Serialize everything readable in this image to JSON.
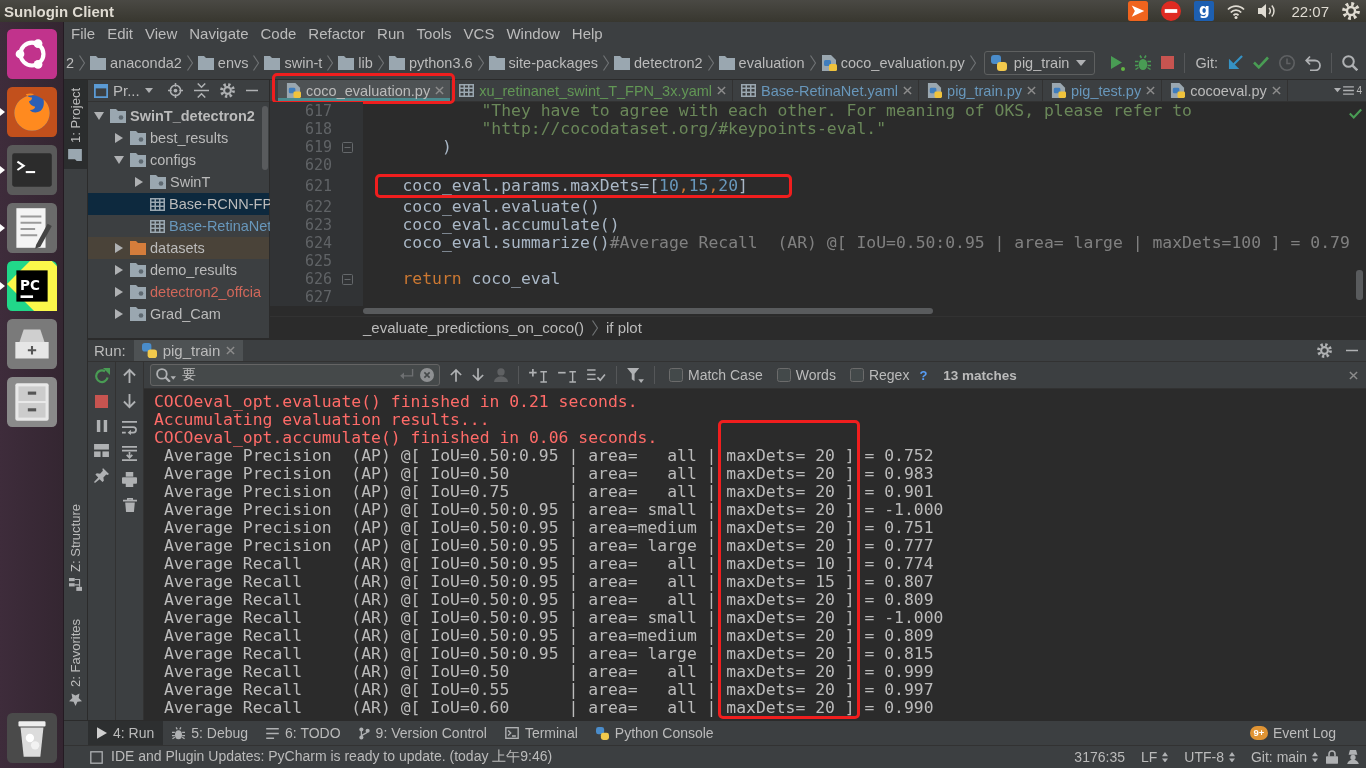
{
  "top_bar": {
    "title": "Sunlogin Client",
    "tray": [
      {
        "kind": "remote"
      },
      {
        "kind": "blocked"
      },
      {
        "kind": "keyboard",
        "label": "g"
      },
      {
        "kind": "wifi"
      },
      {
        "kind": "volume"
      }
    ],
    "clock": "22:07"
  },
  "launcher": [
    {
      "kind": "dash",
      "running": false
    },
    {
      "kind": "browser",
      "running": true
    },
    {
      "kind": "terminal",
      "running": true
    },
    {
      "kind": "editor",
      "running": true
    },
    {
      "kind": "ide",
      "label": "PC",
      "running": true
    },
    {
      "kind": "drive",
      "running": false
    },
    {
      "kind": "cabinet",
      "running": false
    },
    {
      "kind": "trash",
      "running": false
    }
  ],
  "menu": [
    "File",
    "Edit",
    "View",
    "Navigate",
    "Code",
    "Refactor",
    "Run",
    "Tools",
    "VCS",
    "Window",
    "Help"
  ],
  "navigation_bar": {
    "path": [
      {
        "kind": "text",
        "label": "2"
      },
      {
        "kind": "folder",
        "label": "anaconda2"
      },
      {
        "kind": "folder",
        "label": "envs"
      },
      {
        "kind": "folder",
        "label": "swin-t"
      },
      {
        "kind": "folder",
        "label": "lib"
      },
      {
        "kind": "folder",
        "label": "python3.6"
      },
      {
        "kind": "folder",
        "label": "site-packages"
      },
      {
        "kind": "folder",
        "label": "detectron2"
      },
      {
        "kind": "folder",
        "label": "evaluation"
      },
      {
        "kind": "python",
        "label": "coco_evaluation.py"
      }
    ],
    "run_config": "pig_train",
    "vcs_label": "Git:"
  },
  "side_stripe": [
    {
      "label": "1: Project",
      "kind": "project",
      "selected": true
    },
    {
      "label": "Z: Structure",
      "kind": "structure",
      "selected": false
    },
    {
      "label": "2: Favorites",
      "kind": "favorites",
      "selected": false
    }
  ],
  "project": {
    "title": "Pr...",
    "tree": [
      {
        "label": "SwinT_detectron2",
        "kind": "folder",
        "expanded": true,
        "selected": false,
        "children": [
          {
            "label": "best_results",
            "kind": "folder",
            "expanded": false,
            "selected": false
          },
          {
            "label": "configs",
            "kind": "folder",
            "expanded": true,
            "selected": false,
            "children": [
              {
                "label": "SwinT",
                "kind": "folder",
                "expanded": false,
                "selected": false
              },
              {
                "label": "Base-RCNN-FP",
                "kind": "yaml",
                "selected": true
              },
              {
                "label": "Base-RetinaNet",
                "kind": "yaml",
                "selected": false,
                "color": "#6897bb"
              }
            ]
          },
          {
            "label": "datasets",
            "kind": "excluded",
            "expanded": false,
            "selected": false
          },
          {
            "label": "demo_results",
            "kind": "folder",
            "expanded": false,
            "selected": false
          },
          {
            "label": "detectron2_offcia",
            "kind": "folder",
            "expanded": false,
            "selected": false,
            "color": "#d1675a"
          },
          {
            "label": "Grad_Cam",
            "kind": "folder",
            "expanded": false,
            "selected": false
          }
        ]
      }
    ]
  },
  "editor": {
    "tabs": [
      {
        "label": "coco_evaluation.py",
        "kind": "python",
        "selected": true,
        "highlighted": true
      },
      {
        "label": "xu_retinanet_swint_T_FPN_3x.yaml",
        "kind": "yaml",
        "selected": false,
        "highlighted": false,
        "color": "#629755"
      },
      {
        "label": "Base-RetinaNet.yaml",
        "kind": "yaml",
        "selected": false,
        "highlighted": false,
        "color": "#6897bb"
      },
      {
        "label": "pig_train.py",
        "kind": "python",
        "selected": false,
        "highlighted": false,
        "color": "#6897bb"
      },
      {
        "label": "pig_test.py",
        "kind": "python",
        "selected": false,
        "highlighted": false,
        "color": "#6897bb"
      },
      {
        "label": "cocoeval.py",
        "kind": "python",
        "selected": false,
        "highlighted": false
      }
    ],
    "hidden_tabs": "4",
    "lines": [
      {
        "number": "617",
        "highlighted": false,
        "fold": false,
        "tokens": [
          {
            "kind": "string",
            "text": "            \"They have to agree with each other. For meaning of OKS, please refer to"
          }
        ]
      },
      {
        "number": "618",
        "highlighted": false,
        "fold": false,
        "tokens": [
          {
            "kind": "string",
            "text": "            \"http://cocodataset.org/#keypoints-eval.\""
          }
        ]
      },
      {
        "number": "619",
        "highlighted": false,
        "fold": true,
        "tokens": [
          {
            "kind": "plain",
            "text": "        )"
          }
        ]
      },
      {
        "number": "620",
        "highlighted": false,
        "fold": false
      },
      {
        "number": "621",
        "highlighted": true,
        "fold": false,
        "tokens": [
          {
            "kind": "plain",
            "text": "    coco_eval.params.maxDets=["
          },
          {
            "kind": "number",
            "text": "10"
          },
          {
            "kind": "punct",
            "text": ","
          },
          {
            "kind": "number",
            "text": "15"
          },
          {
            "kind": "punct",
            "text": ","
          },
          {
            "kind": "number",
            "text": "20"
          },
          {
            "kind": "plain",
            "text": "]"
          }
        ]
      },
      {
        "number": "622",
        "highlighted": false,
        "fold": false,
        "tokens": [
          {
            "kind": "plain",
            "text": "    coco_eval.evaluate()"
          }
        ]
      },
      {
        "number": "623",
        "highlighted": false,
        "fold": false,
        "tokens": [
          {
            "kind": "plain",
            "text": "    coco_eval.accumulate()"
          }
        ]
      },
      {
        "number": "624",
        "highlighted": false,
        "fold": false,
        "tokens": [
          {
            "kind": "plain",
            "text": "    coco_eval.summarize()"
          },
          {
            "kind": "comment",
            "text": "#Average Recall  (AR) @[ IoU=0.50:0.95 | area= large | maxDets=100 ] = 0.79"
          }
        ]
      },
      {
        "number": "625",
        "highlighted": false,
        "fold": false
      },
      {
        "number": "626",
        "highlighted": false,
        "fold": true,
        "tokens": [
          {
            "kind": "keyword",
            "text": "    return"
          },
          {
            "kind": "plain",
            "text": " coco_eval"
          }
        ]
      },
      {
        "number": "627",
        "highlighted": false,
        "fold": false
      }
    ],
    "breadcrumb": [
      "_evaluate_predictions_on_coco()",
      "if plot"
    ]
  },
  "run_panel": {
    "title": "Run:",
    "tab": "pig_train",
    "search": {
      "value": "要",
      "options": [
        {
          "label": "Match Case",
          "checked": false
        },
        {
          "label": "Words",
          "checked": false
        },
        {
          "label": "Regex",
          "checked": false
        }
      ],
      "help": "?",
      "matches": "13 matches"
    },
    "highlight_column": true,
    "output": [
      {
        "kind": "stderr",
        "text": "COCOeval_opt.evaluate() finished in 0.21 seconds."
      },
      {
        "kind": "stderr",
        "text": "Accumulating evaluation results..."
      },
      {
        "kind": "stderr",
        "text": "COCOeval_opt.accumulate() finished in 0.06 seconds."
      },
      {
        "kind": "stdout",
        "text": " Average Precision  (AP) @[ IoU=0.50:0.95 | area=   all | maxDets= 20 ] = 0.752"
      },
      {
        "kind": "stdout",
        "text": " Average Precision  (AP) @[ IoU=0.50      | area=   all | maxDets= 20 ] = 0.983"
      },
      {
        "kind": "stdout",
        "text": " Average Precision  (AP) @[ IoU=0.75      | area=   all | maxDets= 20 ] = 0.901"
      },
      {
        "kind": "stdout",
        "text": " Average Precision  (AP) @[ IoU=0.50:0.95 | area= small | maxDets= 20 ] = -1.000"
      },
      {
        "kind": "stdout",
        "text": " Average Precision  (AP) @[ IoU=0.50:0.95 | area=medium | maxDets= 20 ] = 0.751"
      },
      {
        "kind": "stdout",
        "text": " Average Precision  (AP) @[ IoU=0.50:0.95 | area= large | maxDets= 20 ] = 0.777"
      },
      {
        "kind": "stdout",
        "text": " Average Recall     (AR) @[ IoU=0.50:0.95 | area=   all | maxDets= 10 ] = 0.774"
      },
      {
        "kind": "stdout",
        "text": " Average Recall     (AR) @[ IoU=0.50:0.95 | area=   all | maxDets= 15 ] = 0.807"
      },
      {
        "kind": "stdout",
        "text": " Average Recall     (AR) @[ IoU=0.50:0.95 | area=   all | maxDets= 20 ] = 0.809"
      },
      {
        "kind": "stdout",
        "text": " Average Recall     (AR) @[ IoU=0.50:0.95 | area= small | maxDets= 20 ] = -1.000"
      },
      {
        "kind": "stdout",
        "text": " Average Recall     (AR) @[ IoU=0.50:0.95 | area=medium | maxDets= 20 ] = 0.809"
      },
      {
        "kind": "stdout",
        "text": " Average Recall     (AR) @[ IoU=0.50:0.95 | area= large | maxDets= 20 ] = 0.815"
      },
      {
        "kind": "stdout",
        "text": " Average Recall     (AR) @[ IoU=0.50      | area=   all | maxDets= 20 ] = 0.999"
      },
      {
        "kind": "stdout",
        "text": " Average Recall     (AR) @[ IoU=0.55      | area=   all | maxDets= 20 ] = 0.997"
      },
      {
        "kind": "stdout",
        "text": " Average Recall     (AR) @[ IoU=0.60      | area=   all | maxDets= 20 ] = 0.990"
      }
    ]
  },
  "tool_tabs": [
    {
      "label": "4: Run",
      "kind": "run",
      "selected": true
    },
    {
      "label": "5: Debug",
      "kind": "debug",
      "selected": false
    },
    {
      "label": "6: TODO",
      "kind": "todo",
      "selected": false
    },
    {
      "label": "9: Version Control",
      "kind": "vcs",
      "selected": false
    },
    {
      "label": "Terminal",
      "kind": "terminal",
      "selected": false
    },
    {
      "label": "Python Console",
      "kind": "console",
      "selected": false
    }
  ],
  "event_log": {
    "label": "Event Log",
    "badge": "9+"
  },
  "status_bar": {
    "message": "IDE and Plugin Updates: PyCharm is ready to update. (today 上午9:46)",
    "position": "3176:35",
    "line_separator": "LF",
    "encoding": "UTF-8",
    "branch": "Git: main"
  }
}
